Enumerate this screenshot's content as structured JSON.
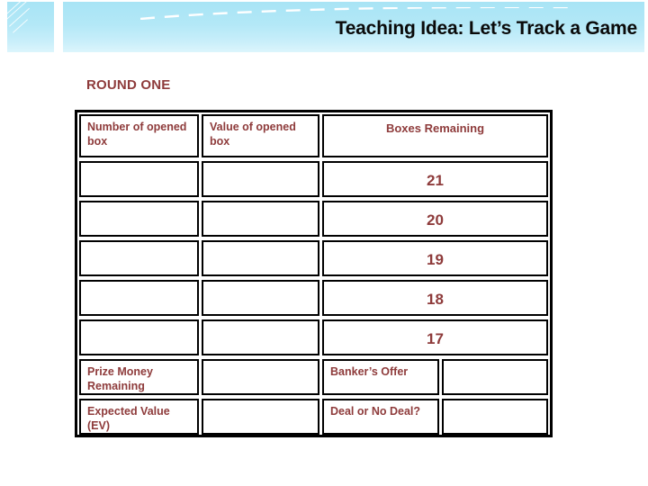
{
  "banner": {
    "title": "Teaching Idea: Let’s Track a Game",
    "bg_color_light": "#dcf5fc",
    "bg_color_dark": "#a8e4f5",
    "title_color": "#0a0a0a"
  },
  "round_label": "ROUND ONE",
  "accent_color": "#8e3b3b",
  "table": {
    "headers": [
      "Number of opened box",
      "Value of opened box",
      "Boxes Remaining"
    ],
    "data_rows": [
      {
        "number_of_opened_box": "",
        "value_of_opened_box": "",
        "boxes_remaining": "21"
      },
      {
        "number_of_opened_box": "",
        "value_of_opened_box": "",
        "boxes_remaining": "20"
      },
      {
        "number_of_opened_box": "",
        "value_of_opened_box": "",
        "boxes_remaining": "19"
      },
      {
        "number_of_opened_box": "",
        "value_of_opened_box": "",
        "boxes_remaining": "18"
      },
      {
        "number_of_opened_box": "",
        "value_of_opened_box": "",
        "boxes_remaining": "17"
      }
    ],
    "summary_rows": [
      {
        "label": "Prize Money Remaining",
        "label_value": "",
        "secondary_label": "Banker’s Offer",
        "secondary_value": ""
      },
      {
        "label": "Expected Value (EV)",
        "label_value": "",
        "secondary_label": "Deal or No Deal?",
        "secondary_value": ""
      }
    ]
  }
}
